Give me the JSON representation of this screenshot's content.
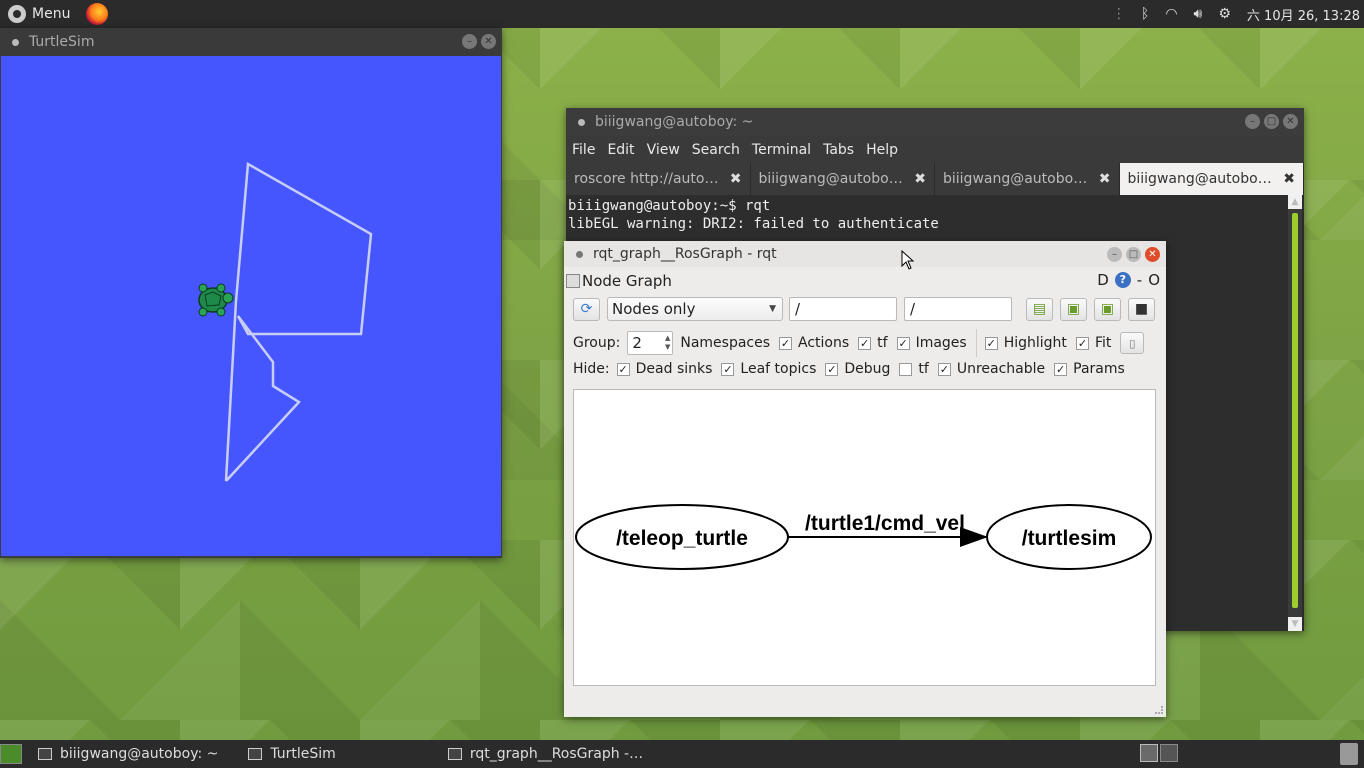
{
  "top_panel": {
    "menu_label": "Menu",
    "clock": "六 10月 26, 13:28",
    "tray_icons": [
      "bluetooth-icon",
      "wifi-icon",
      "volume-icon",
      "settings-icon"
    ]
  },
  "turtlesim": {
    "title": "TurtleSim",
    "background_color": "#4556ff",
    "path_color": "#c8cdf5"
  },
  "terminal": {
    "title": "biiigwang@autoboy: ~",
    "menu": [
      "File",
      "Edit",
      "View",
      "Search",
      "Terminal",
      "Tabs",
      "Help"
    ],
    "tabs": [
      {
        "label": "roscore http://auto…"
      },
      {
        "label": "biiigwang@autobo…"
      },
      {
        "label": "biiigwang@autobo…"
      },
      {
        "label": "biiigwang@autobo…"
      }
    ],
    "lines": [
      "biiigwang@autoboy:~$ rqt",
      "libEGL warning: DRI2: failed to authenticate"
    ]
  },
  "rqt": {
    "title": "rqt_graph__RosGraph - rqt",
    "plugin_title": "Node Graph",
    "head_right": {
      "d": "D",
      "help": "?",
      "dash": "-",
      "o": "O"
    },
    "mode_select": "Nodes only",
    "ns_filter": "/",
    "topic_filter": "/",
    "group_label": "Group:",
    "group_value": "2",
    "group_options": [
      {
        "label": "Namespaces",
        "checked": false
      },
      {
        "label": "Actions",
        "checked": true
      },
      {
        "label": "tf",
        "checked": true
      },
      {
        "label": "Images",
        "checked": true
      }
    ],
    "view_options": [
      {
        "label": "Highlight",
        "checked": true
      },
      {
        "label": "Fit",
        "checked": true
      }
    ],
    "hide_label": "Hide:",
    "hide_options": [
      {
        "label": "Dead sinks",
        "checked": true
      },
      {
        "label": "Leaf topics",
        "checked": true
      },
      {
        "label": "Debug",
        "checked": true
      },
      {
        "label": "tf",
        "checked": false
      },
      {
        "label": "Unreachable",
        "checked": true
      },
      {
        "label": "Params",
        "checked": true
      }
    ],
    "graph": {
      "nodes": [
        "/teleop_turtle",
        "/turtlesim"
      ],
      "edge_label": "/turtle1/cmd_vel"
    }
  },
  "taskbar": {
    "items": [
      "biiigwang@autoboy: ~",
      "TurtleSim",
      "rqt_graph__RosGraph -…"
    ]
  }
}
